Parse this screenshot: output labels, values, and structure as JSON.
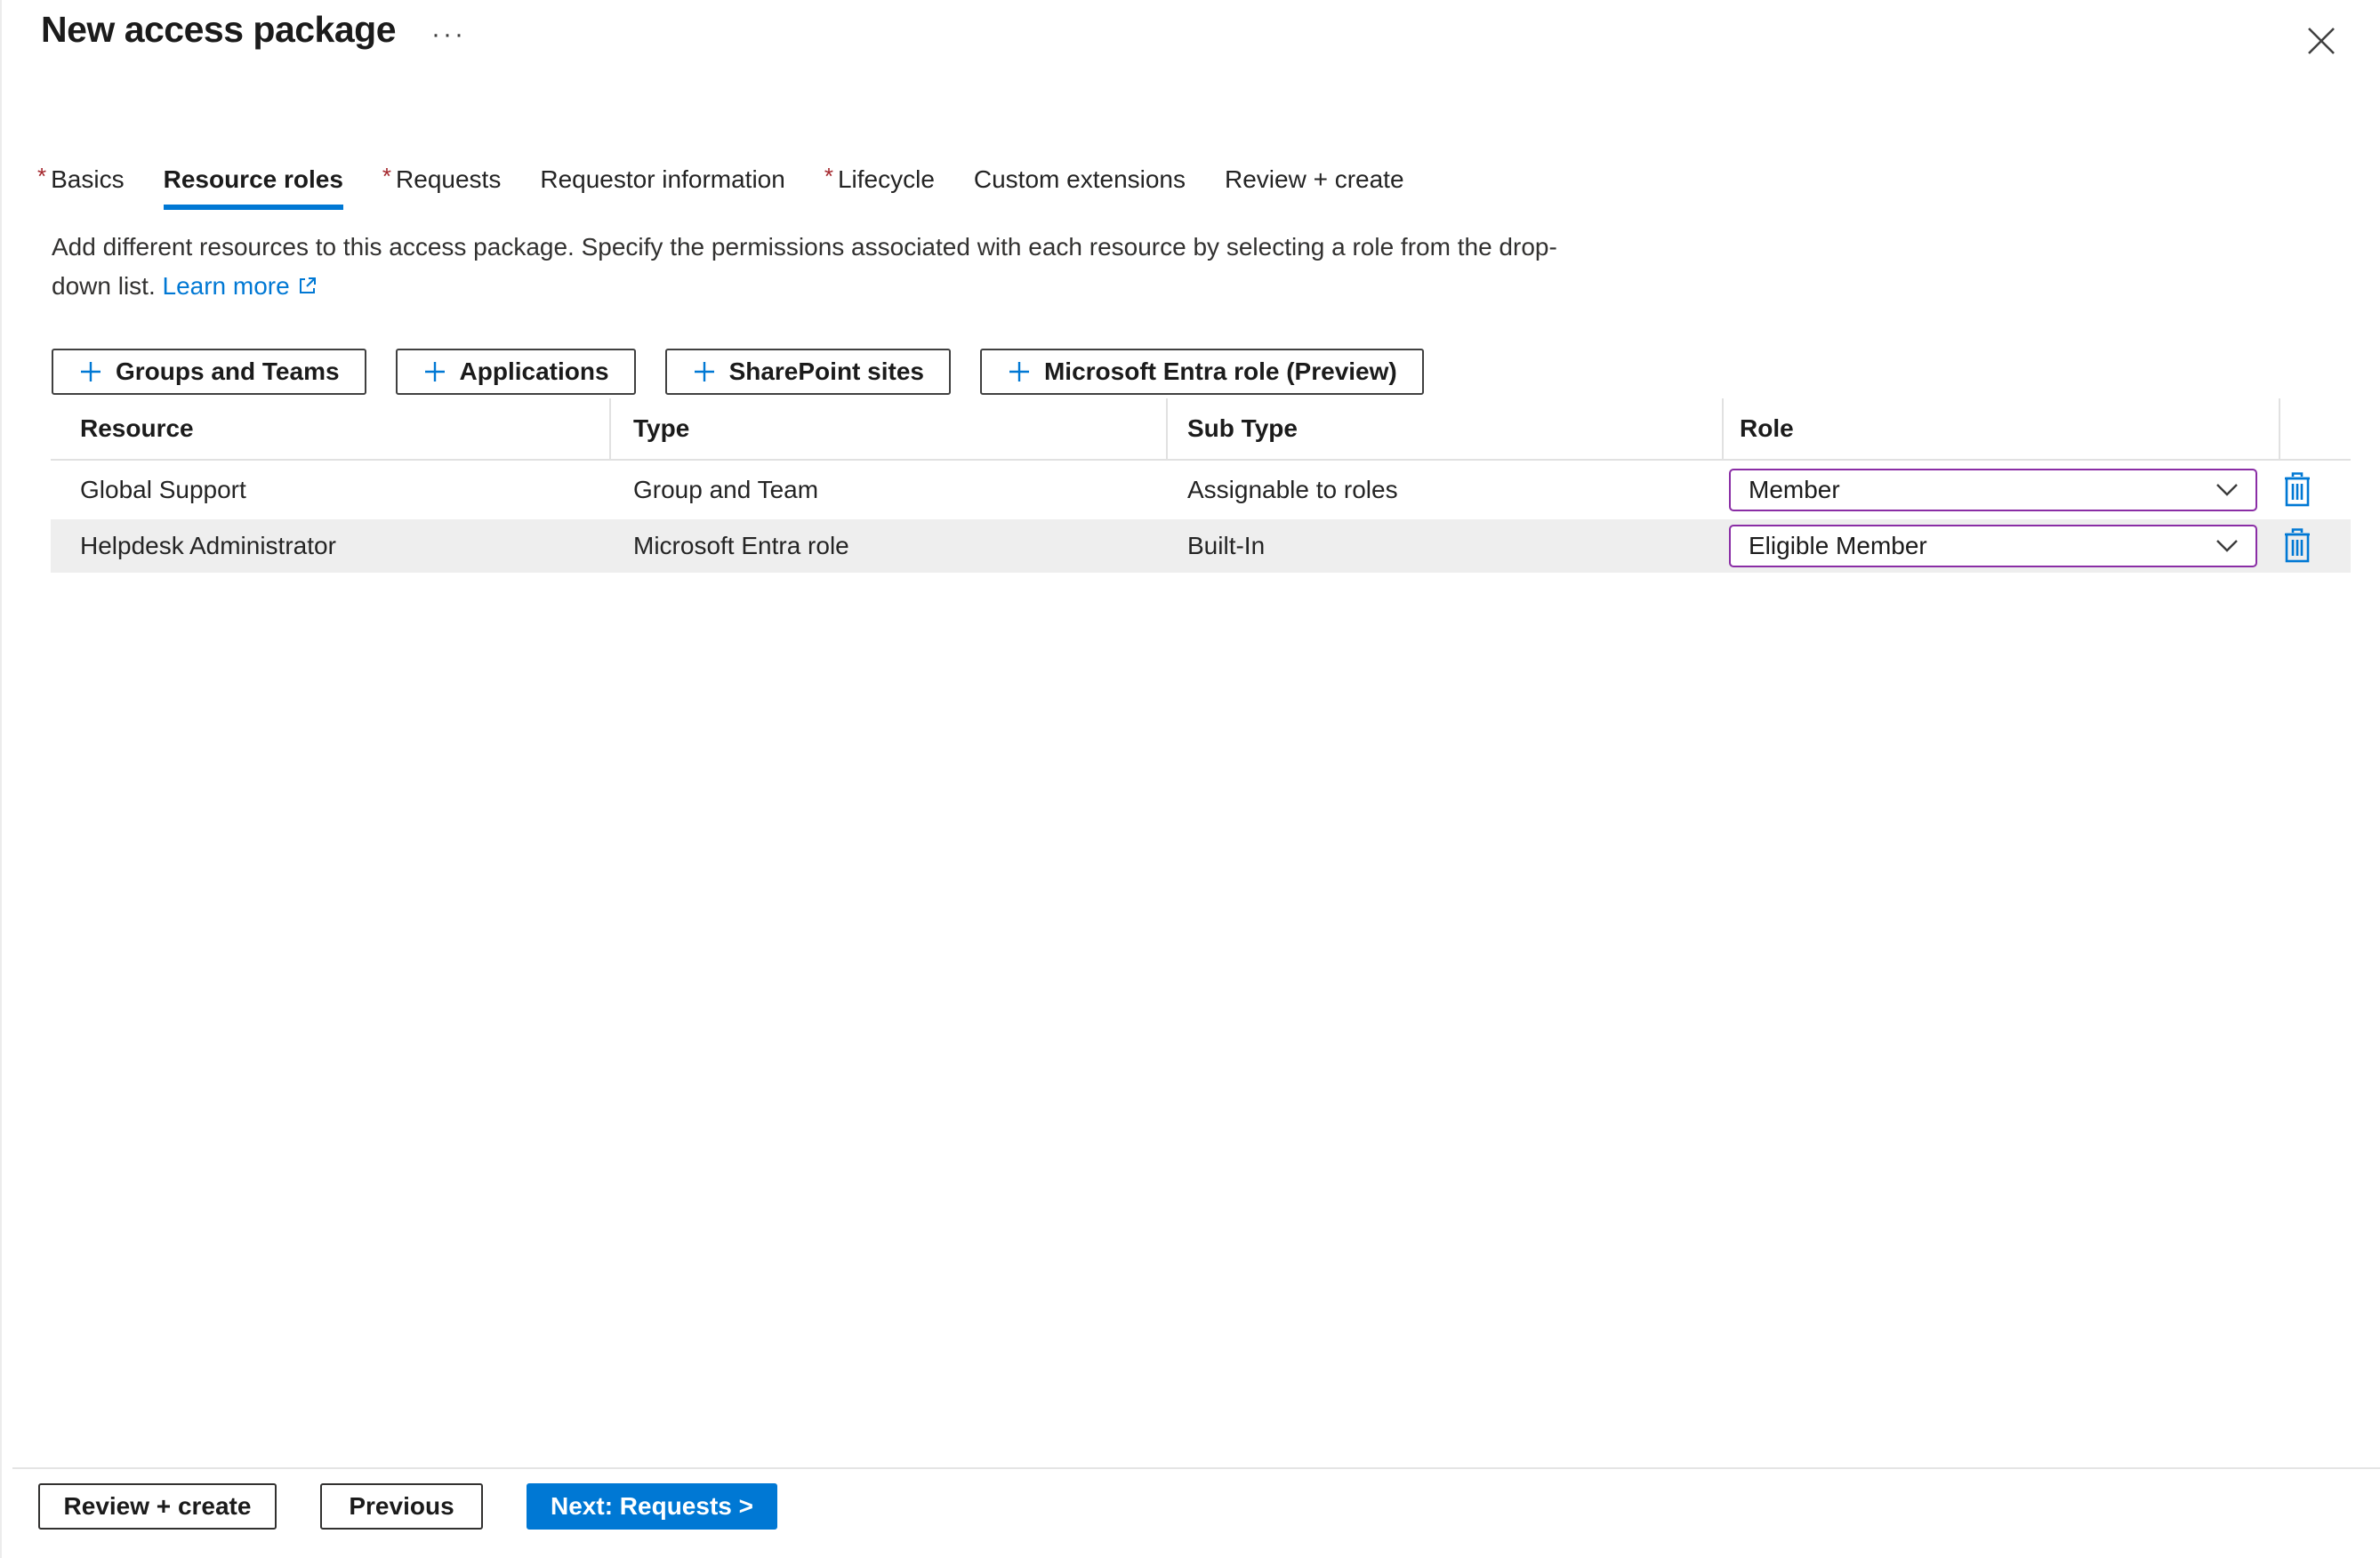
{
  "header": {
    "title": "New access package",
    "more_options": "···"
  },
  "tabs": [
    {
      "label": "Basics",
      "required_mark": "*"
    },
    {
      "label": "Resource roles",
      "active": true
    },
    {
      "label": "Requests",
      "required_mark": "*"
    },
    {
      "label": "Requestor information"
    },
    {
      "label": "Lifecycle",
      "required_mark": "*"
    },
    {
      "label": "Custom extensions"
    },
    {
      "label": "Review + create"
    }
  ],
  "description": {
    "text": "Add different resources to this access package. Specify the permissions associated with each resource by selecting a role from the drop-down list.",
    "link_label": "Learn more"
  },
  "add_buttons": [
    {
      "label": "Groups and Teams"
    },
    {
      "label": "Applications"
    },
    {
      "label": "SharePoint sites"
    },
    {
      "label": "Microsoft Entra role (Preview)"
    }
  ],
  "table": {
    "columns": {
      "resource": "Resource",
      "type": "Type",
      "sub_type": "Sub Type",
      "role": "Role"
    },
    "rows": [
      {
        "resource": "Global Support",
        "type": "Group and Team",
        "sub_type": "Assignable to roles",
        "role": "Member"
      },
      {
        "resource": "Helpdesk Administrator",
        "type": "Microsoft Entra role",
        "sub_type": "Built-In",
        "role": "Eligible Member"
      }
    ]
  },
  "footer": {
    "review_create": "Review + create",
    "previous": "Previous",
    "next": "Next: Requests >"
  },
  "colors": {
    "accent": "#0078d4",
    "required_asterisk": "#a4262c",
    "role_dropdown_border": "#8A2DA5",
    "alt_row_bg": "#eeeeee"
  }
}
